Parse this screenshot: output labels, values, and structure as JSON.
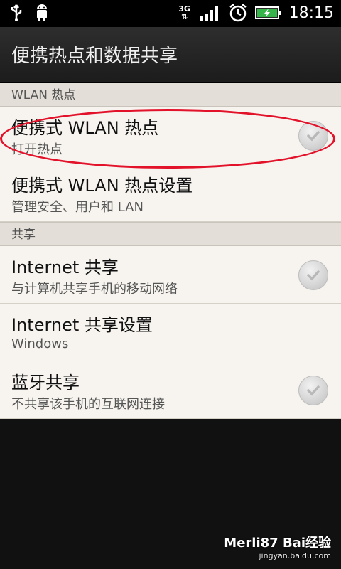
{
  "status_bar": {
    "time": "18:15",
    "network_type": "3G",
    "icons": [
      "usb-icon",
      "android-icon",
      "signal-icon",
      "alarm-icon",
      "battery-charging-icon"
    ]
  },
  "header": {
    "title": "便携热点和数据共享"
  },
  "sections": [
    {
      "header": "WLAN 热点",
      "items": [
        {
          "title": "便携式 WLAN 热点",
          "subtitle": "打开热点",
          "has_check": true,
          "checked": false
        },
        {
          "title": "便携式 WLAN 热点设置",
          "subtitle": "管理安全、用户和 LAN",
          "has_check": false
        }
      ]
    },
    {
      "header": "共享",
      "items": [
        {
          "title": "Internet 共享",
          "subtitle": "与计算机共享手机的移动网络",
          "has_check": true,
          "checked": false
        },
        {
          "title": "Internet 共享设置",
          "subtitle": "Windows",
          "has_check": false
        },
        {
          "title": "蓝牙共享",
          "subtitle": "不共享该手机的互联网连接",
          "has_check": true,
          "checked": false
        }
      ]
    }
  ],
  "watermark": {
    "text": "Merli87 Bai经验",
    "url": "jingyan.baidu.com"
  },
  "colors": {
    "highlight_oval": "#e3122b",
    "list_bg": "#f7f4ef",
    "section_bg": "#e3dfd8"
  }
}
